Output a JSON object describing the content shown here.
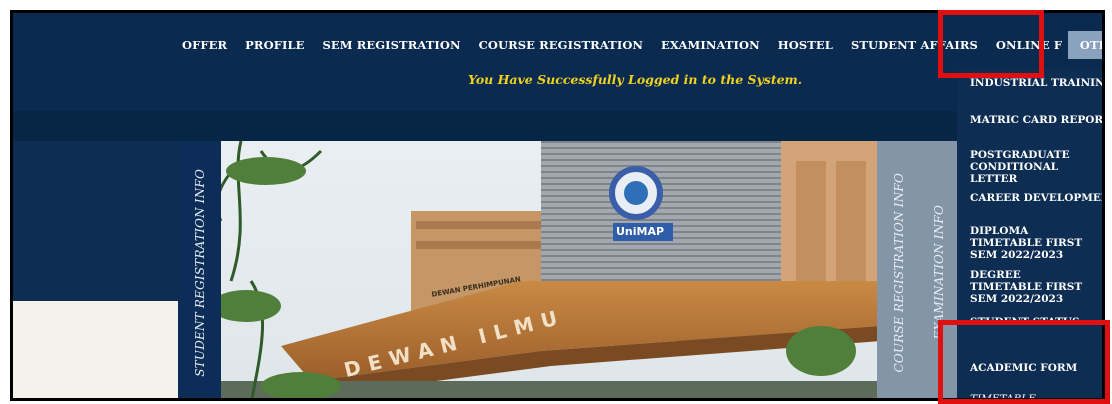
{
  "nav": {
    "items": [
      "OFFER",
      "PROFILE",
      "SEM REGISTRATION",
      "COURSE REGISTRATION",
      "EXAMINATION",
      "HOSTEL",
      "STUDENT AFFAIRS",
      "ONLINE FOR"
    ],
    "active": "OTHERS"
  },
  "welcome_message": "You Have Successfully Logged in to the System.",
  "panels": {
    "student_registration": "STUDENT REGISTRATION INFO",
    "course_registration": "COURSE REGISTRATION INFO",
    "examination": "EXAMINATION INFO"
  },
  "photo": {
    "building_sign": "DEWAN ILMU",
    "side_sign": "DEWAN PERHIMPUNAN",
    "logo_text": "UniMAP"
  },
  "dropdown": {
    "items": [
      "INDUSTRIAL TRAINING",
      "MATRIC CARD REPORT",
      "POSTGRADUATE CONDITIONAL LETTER",
      "CAREER DEVELOPMENT",
      "DIPLOMA TIMETABLE FIRST SEM 2022/2023",
      "DEGREE TIMETABLE FIRST SEM 2022/2023",
      "STUDENT STATUS",
      "ACADEMIC FORM",
      "TIMETABLE"
    ]
  },
  "colors": {
    "nav_bg": "#0a2b4f",
    "active_tab": "#8aa2bd",
    "welcome": "#f2d21f",
    "highlight": "#e01010"
  }
}
